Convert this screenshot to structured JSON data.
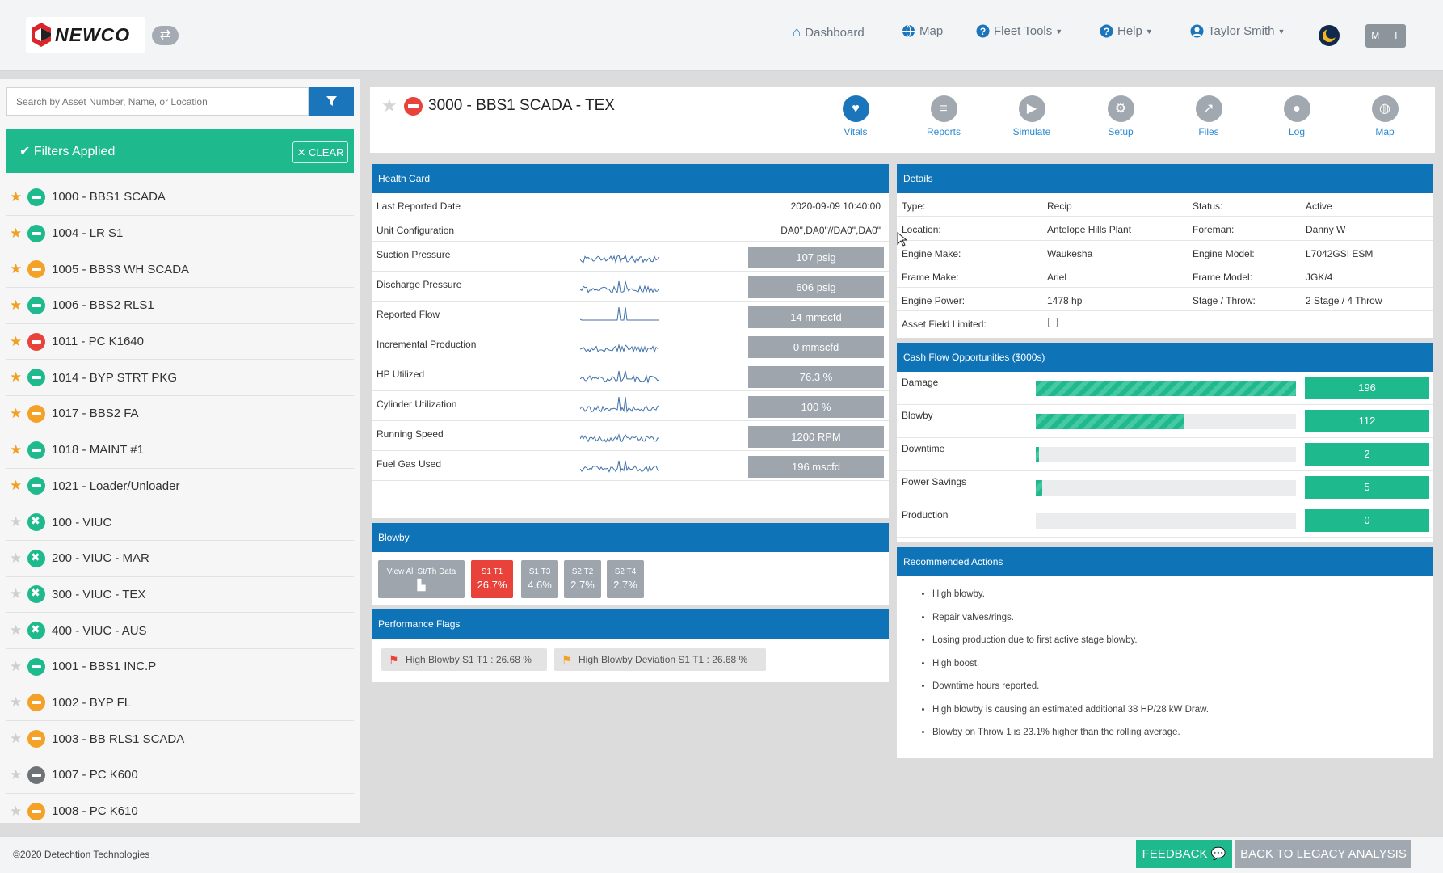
{
  "header": {
    "brand": "NEWCO",
    "nav": {
      "dashboard": "Dashboard",
      "map": "Map",
      "fleet_tools": "Fleet Tools",
      "help": "Help",
      "user": "Taylor Smith"
    },
    "units_toggle": {
      "m": "M",
      "i": "I"
    }
  },
  "sidebar": {
    "search_placeholder": "Search by Asset Number, Name, or Location",
    "filters_label": "Filters Applied",
    "clear_label": "CLEAR",
    "assets": [
      {
        "label": "1000 - BBS1 SCADA",
        "favorite": true,
        "status": "green"
      },
      {
        "label": "1004 - LR S1",
        "favorite": true,
        "status": "green"
      },
      {
        "label": "1005 - BBS3 WH SCADA",
        "favorite": true,
        "status": "orange"
      },
      {
        "label": "1006 - BBS2 RLS1",
        "favorite": true,
        "status": "green"
      },
      {
        "label": "1011 - PC K1640",
        "favorite": true,
        "status": "red"
      },
      {
        "label": "1014 - BYP STRT PKG",
        "favorite": true,
        "status": "green"
      },
      {
        "label": "1017 - BBS2 FA",
        "favorite": true,
        "status": "orange"
      },
      {
        "label": "1018 - MAINT #1",
        "favorite": true,
        "status": "green"
      },
      {
        "label": "1021 - Loader/Unloader",
        "favorite": true,
        "status": "green"
      },
      {
        "label": "100 - VIUC",
        "favorite": false,
        "status": "green-x"
      },
      {
        "label": "200 - VIUC - MAR",
        "favorite": false,
        "status": "green-x"
      },
      {
        "label": "300 - VIUC - TEX",
        "favorite": false,
        "status": "green-x"
      },
      {
        "label": "400 - VIUC - AUS",
        "favorite": false,
        "status": "green-x"
      },
      {
        "label": "1001 - BBS1 INC.P",
        "favorite": false,
        "status": "green"
      },
      {
        "label": "1002 - BYP FL",
        "favorite": false,
        "status": "orange"
      },
      {
        "label": "1003 - BB RLS1 SCADA",
        "favorite": false,
        "status": "orange"
      },
      {
        "label": "1007 - PC K600",
        "favorite": false,
        "status": "grey"
      },
      {
        "label": "1008 - PC K610",
        "favorite": false,
        "status": "orange"
      }
    ]
  },
  "asset": {
    "title": "3000 - BBS1 SCADA - TEX",
    "tabs": [
      "Vitals",
      "Reports",
      "Simulate",
      "Setup",
      "Files",
      "Log",
      "Map"
    ]
  },
  "health_card": {
    "title": "Health Card",
    "last_reported_label": "Last Reported Date",
    "last_reported_value": "2020-09-09 10:40:00",
    "unit_config_label": "Unit Configuration",
    "unit_config_value": "DA0\",DA0\"//DA0\",DA0\"",
    "metrics": [
      {
        "label": "Suction Pressure",
        "value": "107 psig"
      },
      {
        "label": "Discharge Pressure",
        "value": "606 psig"
      },
      {
        "label": "Reported Flow",
        "value": "14 mmscfd"
      },
      {
        "label": "Incremental Production",
        "value": "0 mmscfd"
      },
      {
        "label": "HP Utilized",
        "value": "76.3 %"
      },
      {
        "label": "Cylinder Utilization",
        "value": "100 %"
      },
      {
        "label": "Running Speed",
        "value": "1200 RPM"
      },
      {
        "label": "Fuel Gas Used",
        "value": "196 mscfd"
      }
    ]
  },
  "blowby": {
    "title": "Blowby",
    "view_all_label": "View All St/Th Data",
    "items": [
      {
        "label": "S1 T1",
        "value": "26.7%",
        "color": "#e8423a"
      },
      {
        "label": "S1 T3",
        "value": "4.6%",
        "color": "#9ea5ac"
      },
      {
        "label": "S2 T2",
        "value": "2.7%",
        "color": "#9ea5ac"
      },
      {
        "label": "S2 T4",
        "value": "2.7%",
        "color": "#9ea5ac"
      }
    ]
  },
  "performance_flags": {
    "title": "Performance Flags",
    "flags": [
      {
        "label": "High Blowby S1 T1 : 26.68 %",
        "color": "#e8423a"
      },
      {
        "label": "High Blowby Deviation S1 T1 : 26.68 %",
        "color": "#f4a128"
      }
    ]
  },
  "details": {
    "title": "Details",
    "rows": [
      {
        "l1": "Type:",
        "v1": "Recip",
        "l2": "Status:",
        "v2": "Active"
      },
      {
        "l1": "Location:",
        "v1": "Antelope Hills Plant",
        "l2": "Foreman:",
        "v2": "Danny W"
      },
      {
        "l1": "Engine Make:",
        "v1": "Waukesha",
        "l2": "Engine Model:",
        "v2": "L7042GSI ESM"
      },
      {
        "l1": "Frame Make:",
        "v1": "Ariel",
        "l2": "Frame Model:",
        "v2": "JGK/4"
      },
      {
        "l1": "Engine Power:",
        "v1": "1478 hp",
        "l2": "Stage / Throw:",
        "v2": "2 Stage / 4 Throw"
      }
    ],
    "field_limited_label": "Asset Field Limited:"
  },
  "cash_flow": {
    "title": "Cash Flow Opportunities ($000s)",
    "items": [
      {
        "label": "Damage",
        "value": "196",
        "fraction": 1.0
      },
      {
        "label": "Blowby",
        "value": "112",
        "fraction": 0.571
      },
      {
        "label": "Downtime",
        "value": "2",
        "fraction": 0.012
      },
      {
        "label": "Power Savings",
        "value": "5",
        "fraction": 0.025
      },
      {
        "label": "Production",
        "value": "0",
        "fraction": 0
      }
    ]
  },
  "recommended_actions": {
    "title": "Recommended Actions",
    "items": [
      "High blowby.",
      "Repair valves/rings.",
      "Losing production due to first active stage blowby.",
      "High boost.",
      "Downtime hours reported.",
      "High blowby is causing an estimated additional 38 HP/28 kW Draw.",
      "Blowby on Throw 1 is 23.1% higher than the rolling average."
    ]
  },
  "footer": {
    "copyright": "©2020 Detechtion Technologies",
    "feedback_label": "FEEDBACK",
    "legacy_label": "BACK TO LEGACY ANALYSIS"
  },
  "colors": {
    "primary": "#1b75bb",
    "accent": "#1eb98c",
    "danger": "#e8423a",
    "warning": "#f4a128"
  }
}
